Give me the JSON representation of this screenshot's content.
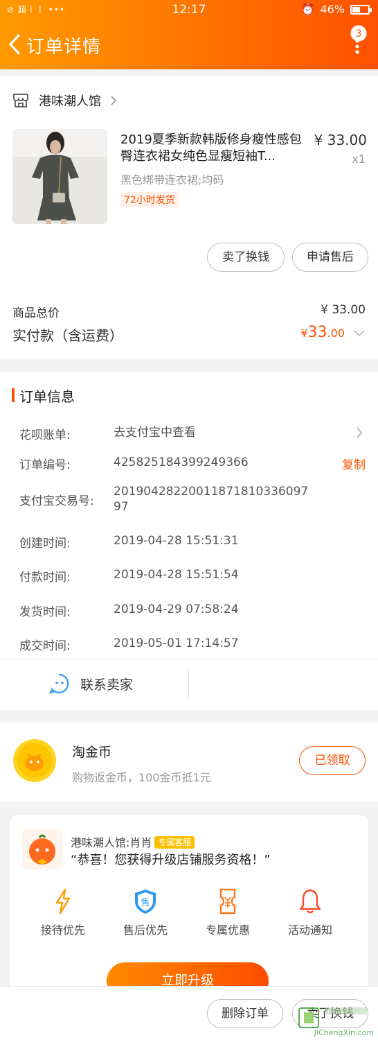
{
  "status_bar": {
    "left": "⊘ 超丨丨 •••",
    "time": "12:17",
    "battery": "46%"
  },
  "header": {
    "title": "订单详情",
    "badge": "3"
  },
  "shop": {
    "name": "港味潮人馆"
  },
  "product": {
    "title": "2019夏季新款韩版修身瘦性感包臀连衣裙女纯色显瘦短袖T...",
    "price": "¥ 33.00",
    "qty": "x1",
    "sku": "黑色绑带连衣裙;均码",
    "ship_tag": "72小时发货"
  },
  "actions": {
    "sell": "卖了换钱",
    "aftersale": "申请售后"
  },
  "price_summary": {
    "total_label": "商品总价",
    "total_value": "¥ 33.00",
    "paid_label": "实付款（含运费）",
    "paid_currency": "¥",
    "paid_int": "33",
    "paid_dec": ".00"
  },
  "order_info": {
    "title": "订单信息",
    "rows": [
      {
        "key": "花呗账单:",
        "value": "去支付宝中查看"
      },
      {
        "key": "订单编号:",
        "value": "425825184399249366"
      },
      {
        "key": "支付宝交易号:",
        "value": "20190428220011871810336097 97"
      },
      {
        "key": "创建时间:",
        "value": "2019-04-28 15:51:31"
      },
      {
        "key": "付款时间:",
        "value": "2019-04-28 15:51:54"
      },
      {
        "key": "发货时间:",
        "value": "2019-04-29 07:58:24"
      },
      {
        "key": "成交时间:",
        "value": "2019-05-01 17:14:57"
      }
    ],
    "copy": "复制",
    "contact": "联系卖家"
  },
  "coin": {
    "title": "淘金币",
    "desc": "购物返金币，100金币抵1元",
    "button": "已领取"
  },
  "service": {
    "name": "港味潮人馆:肖肖",
    "tag": "专属客服",
    "message": "“恭喜！您获得升级店铺服务资格！”",
    "perks": [
      "接待优先",
      "售后优先",
      "专属优惠",
      "活动通知"
    ],
    "upgrade": "立即升级"
  },
  "bottom": {
    "delete": "删除订单",
    "sell": "卖了换钱",
    "watermark": "JiChengXin.com"
  },
  "colors": {
    "accent": "#ff5000",
    "header_start": "#ff9a00",
    "header_end": "#ff5000"
  }
}
